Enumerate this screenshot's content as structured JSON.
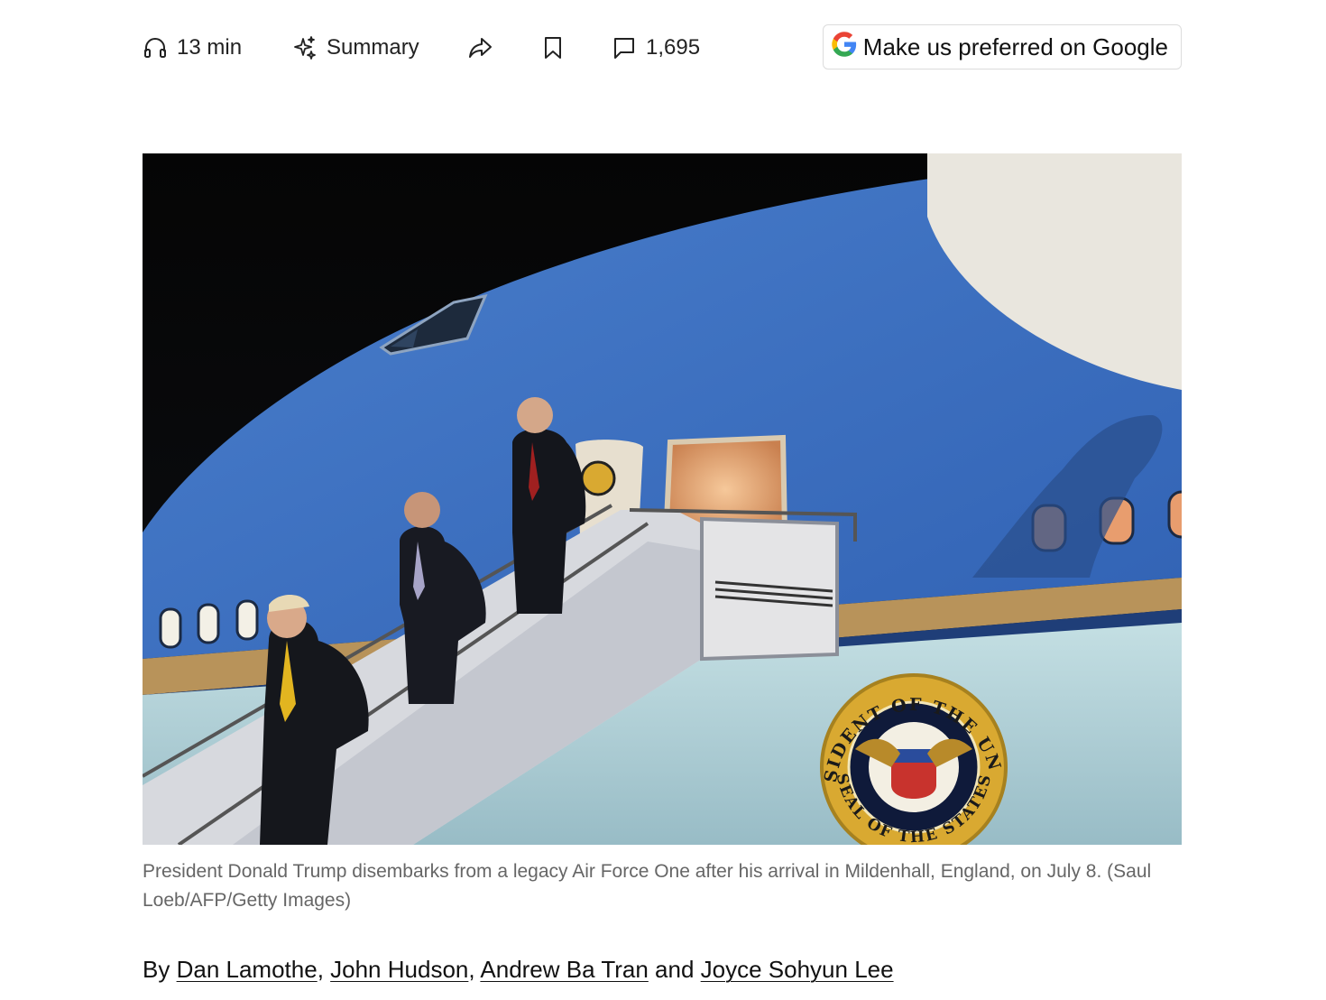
{
  "toolbar": {
    "listen_label": "13 min",
    "summary_label": "Summary",
    "comments_count": "1,695",
    "google_label": "Make us preferred on Google",
    "icons": [
      "headphones-icon",
      "sparkle-icon",
      "share-icon",
      "bookmark-icon",
      "comment-icon",
      "google-logo-icon"
    ]
  },
  "image": {
    "seal_top_text": "PRESIDENT OF THE UNITED",
    "seal_bottom_text": "SEAL OF THE STATES"
  },
  "caption": {
    "text": "President Donald Trump disembarks from a legacy Air Force One after his arrival in Mildenhall, England, on July 8. (Saul Loeb/AFP/Getty Images)"
  },
  "byline": {
    "prefix": "By ",
    "authors": [
      "Dan Lamothe",
      "John Hudson",
      "Andrew Ba Tran",
      "Joyce Sohyun Lee"
    ],
    "sep1": ", ",
    "sep2": ", ",
    "sep3": " and "
  },
  "colors": {
    "fuselage_blue": "#3c6fbe",
    "fuselage_light": "#b6d6dc",
    "gold_stripe": "#b8935a",
    "seal_gold": "#d9a931",
    "caption_gray": "#666666"
  }
}
